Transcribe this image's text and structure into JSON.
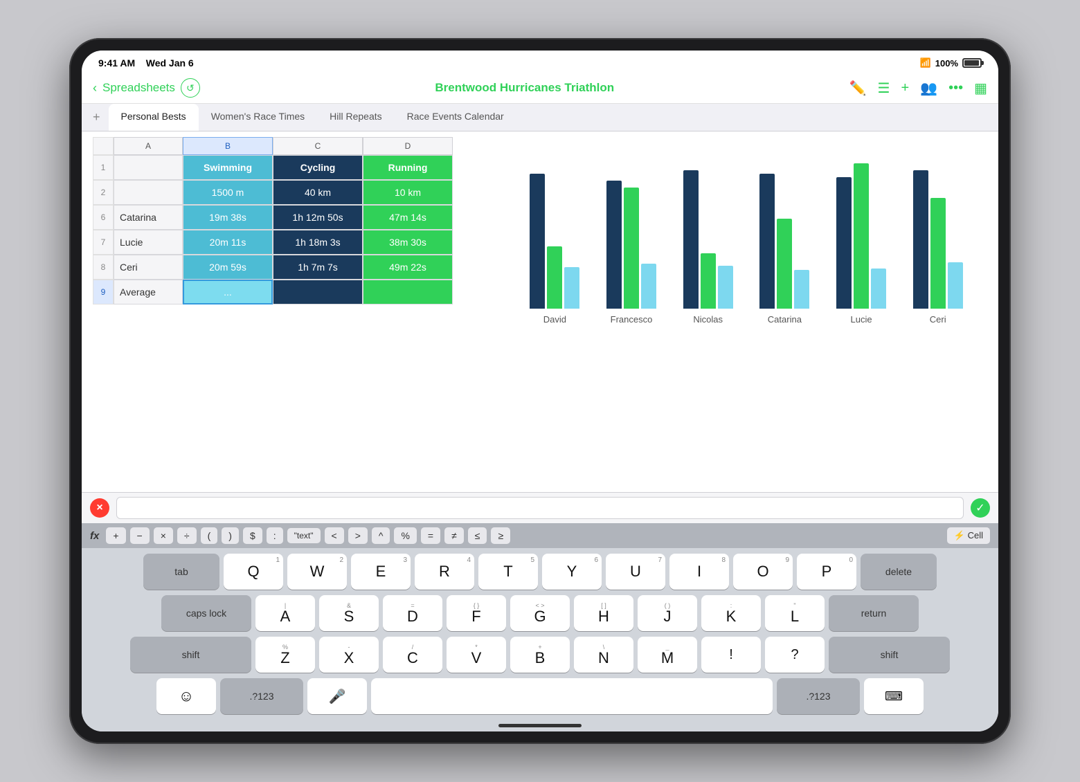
{
  "status": {
    "time": "9:41 AM",
    "date": "Wed Jan 6",
    "battery": "100%"
  },
  "toolbar": {
    "back_label": "Spreadsheets",
    "title": "Brentwood Hurricanes Triathlon"
  },
  "tabs": [
    {
      "id": "personal-bests",
      "label": "Personal Bests",
      "active": true
    },
    {
      "id": "womens-race-times",
      "label": "Women's Race Times",
      "active": false
    },
    {
      "id": "hill-repeats",
      "label": "Hill Repeats",
      "active": false
    },
    {
      "id": "race-events-calendar",
      "label": "Race Events Calendar",
      "active": false
    }
  ],
  "spreadsheet": {
    "columns": [
      "A",
      "B",
      "C",
      "D"
    ],
    "headers": {
      "b": "Swimming",
      "c": "Cycling",
      "d": "Running"
    },
    "subheaders": {
      "b": "1500 m",
      "c": "40 km",
      "d": "10 km"
    },
    "rows": [
      {
        "num": 6,
        "name": "Catarina",
        "swim": "19m 38s",
        "cycle": "1h 12m 50s",
        "run": "47m 14s"
      },
      {
        "num": 7,
        "name": "Lucie",
        "swim": "20m 11s",
        "cycle": "1h 18m 3s",
        "run": "38m 30s"
      },
      {
        "num": 8,
        "name": "Ceri",
        "swim": "20m 59s",
        "cycle": "1h 7m 7s",
        "run": "49m 22s"
      },
      {
        "num": 9,
        "name": "Average",
        "swim": "...",
        "cycle": "",
        "run": ""
      }
    ]
  },
  "chart": {
    "labels": [
      "David",
      "Francesco",
      "Nicolas",
      "Catarina",
      "Lucie",
      "Ceri"
    ],
    "groups": [
      {
        "name": "David",
        "dark": 195,
        "green": 90,
        "light": 60
      },
      {
        "name": "Francesco",
        "dark": 185,
        "green": 175,
        "light": 65
      },
      {
        "name": "Nicolas",
        "dark": 200,
        "green": 80,
        "light": 62
      },
      {
        "name": "Catarina",
        "dark": 195,
        "green": 130,
        "light": 56
      },
      {
        "name": "Lucie",
        "dark": 190,
        "green": 210,
        "light": 58
      },
      {
        "name": "Ceri",
        "dark": 200,
        "green": 160,
        "light": 67
      }
    ]
  },
  "formula_bar": {
    "cancel_label": "×",
    "confirm_label": "✓",
    "placeholder": ""
  },
  "formula_toolbar": {
    "fx_label": "fx",
    "ops": [
      "+",
      "−",
      "×",
      "÷",
      "(",
      ")",
      "$",
      ":",
      "\"text\"",
      "<",
      ">",
      "^",
      "%",
      "=",
      "≠",
      "≤",
      "≥"
    ],
    "cell_label": "⚡ Cell"
  },
  "keyboard": {
    "rows": [
      [
        "Q",
        "W",
        "E",
        "R",
        "T",
        "Y",
        "U",
        "I",
        "O",
        "P"
      ],
      [
        "A",
        "S",
        "D",
        "F",
        "G",
        "H",
        "J",
        "K",
        "L"
      ],
      [
        "Z",
        "X",
        "C",
        "V",
        "B",
        "N",
        "M"
      ]
    ],
    "numbers": [
      "1",
      "2",
      "3",
      "4",
      "5",
      "6",
      "7",
      "8",
      "9",
      "0"
    ],
    "tab_label": "tab",
    "caps_label": "caps lock",
    "shift_label": "shift",
    "delete_label": "delete",
    "return_label": "return",
    "emoji_label": "☺",
    "numeric_label": ".?123",
    "mic_label": "🎤",
    "space_label": "",
    "keyboard_hide_label": "⌨"
  }
}
